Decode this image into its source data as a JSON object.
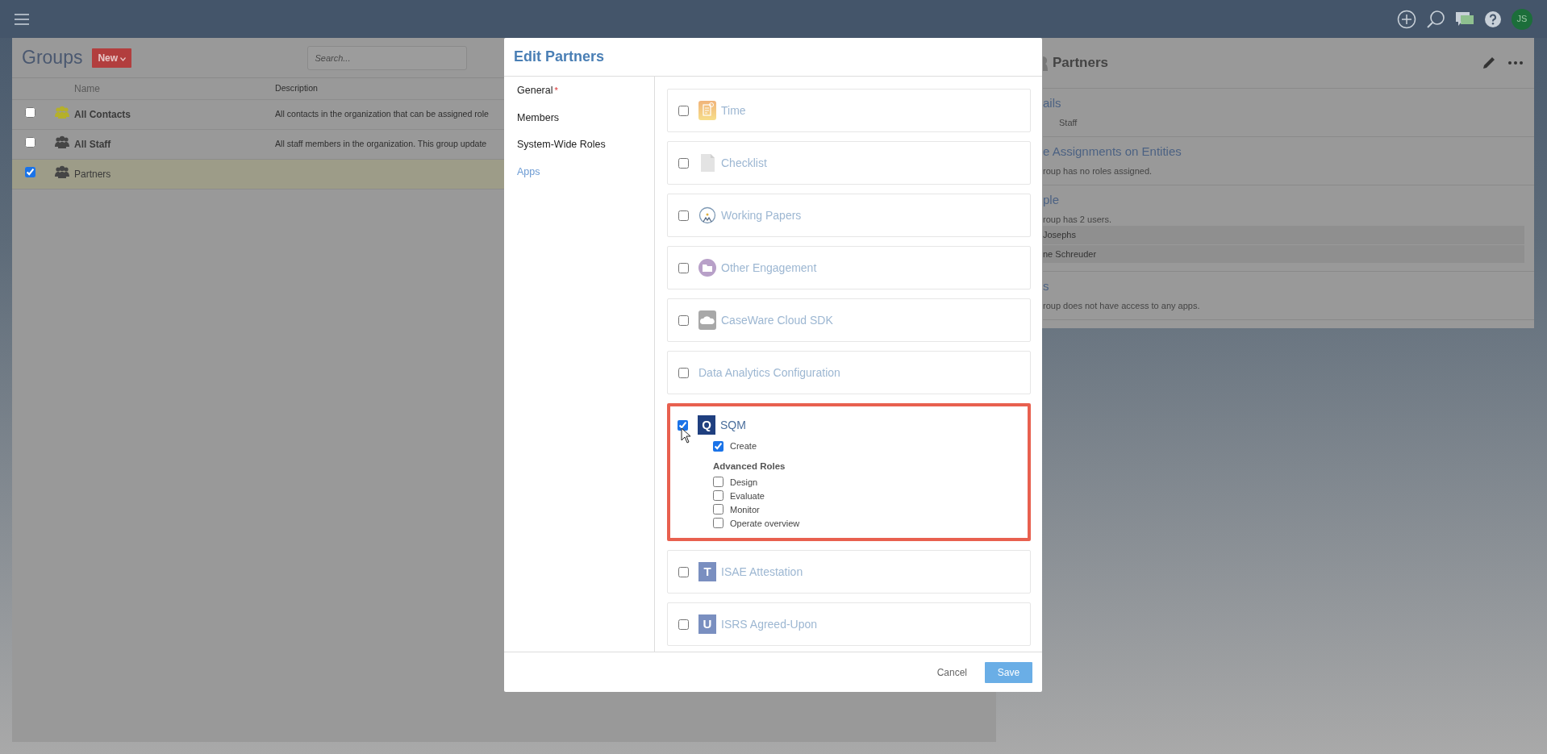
{
  "topbar": {
    "avatar": "JS"
  },
  "groups_panel": {
    "title": "Groups",
    "new_button": "New",
    "search": {
      "placeholder": "Search..."
    },
    "columns": [
      "Name",
      "Description"
    ],
    "rows": [
      {
        "name": "All Contacts",
        "description": "All contacts in the organization that can be assigned role",
        "selected": false,
        "builtin": true,
        "color": "#b5b02a"
      },
      {
        "name": "All Staff",
        "description": "All staff members in the organization. This group update",
        "selected": false,
        "builtin": true,
        "color": "#454545"
      },
      {
        "name": "Partners",
        "description": "",
        "selected": true,
        "builtin": false,
        "color": "#454545"
      }
    ]
  },
  "details_panel": {
    "title": "Partners",
    "sections": [
      {
        "heading": "ails",
        "lines": [
          "Staff"
        ]
      },
      {
        "heading": "e Assignments on Entities",
        "lines": [
          "roup has no roles assigned."
        ]
      },
      {
        "heading": "ple",
        "lines": [
          "roup has 2 users."
        ],
        "users": [
          "Josephs",
          "ne Schreuder"
        ]
      },
      {
        "heading": "s",
        "lines": [
          "roup does not have access to any apps."
        ]
      }
    ]
  },
  "modal": {
    "title": "Edit Partners",
    "nav": [
      {
        "label": "General",
        "required_mark": "*",
        "selected": false
      },
      {
        "label": "Members",
        "selected": false
      },
      {
        "label": "System-Wide Roles",
        "selected": false
      },
      {
        "label": "Apps",
        "selected": true
      }
    ],
    "apps": [
      {
        "name": "Time",
        "kind": "time",
        "checked": false,
        "highlighted": false
      },
      {
        "name": "Checklist",
        "kind": "checklist",
        "checked": false,
        "highlighted": false
      },
      {
        "name": "Working Papers",
        "kind": "working-papers",
        "checked": false,
        "highlighted": false
      },
      {
        "name": "Other Engagement",
        "kind": "engagement",
        "checked": false,
        "highlighted": false
      },
      {
        "name": "CaseWare Cloud SDK",
        "kind": "cloud",
        "checked": false,
        "highlighted": false
      },
      {
        "name": "Data Analytics Configuration",
        "kind": "plain",
        "checked": false,
        "highlighted": false
      },
      {
        "name": "SQM",
        "kind": "letter",
        "letter": "Q",
        "color": "#1f3f7f",
        "checked": true,
        "highlighted": true,
        "roles": [
          {
            "label": "Create",
            "checked": true
          }
        ],
        "advanced_heading": "Advanced Roles",
        "advanced_roles": [
          {
            "label": "Design",
            "checked": false
          },
          {
            "label": "Evaluate",
            "checked": false
          },
          {
            "label": "Monitor",
            "checked": false
          },
          {
            "label": "Operate overview",
            "checked": false
          }
        ]
      },
      {
        "name": "ISAE Attestation",
        "kind": "letter",
        "letter": "T",
        "color": "#7a8fc0",
        "checked": false,
        "highlighted": false
      },
      {
        "name": "ISRS Agreed-Upon",
        "kind": "letter",
        "letter": "U",
        "color": "#7a8fc0",
        "checked": false,
        "highlighted": false
      }
    ],
    "cancel": "Cancel",
    "save": "Save"
  }
}
